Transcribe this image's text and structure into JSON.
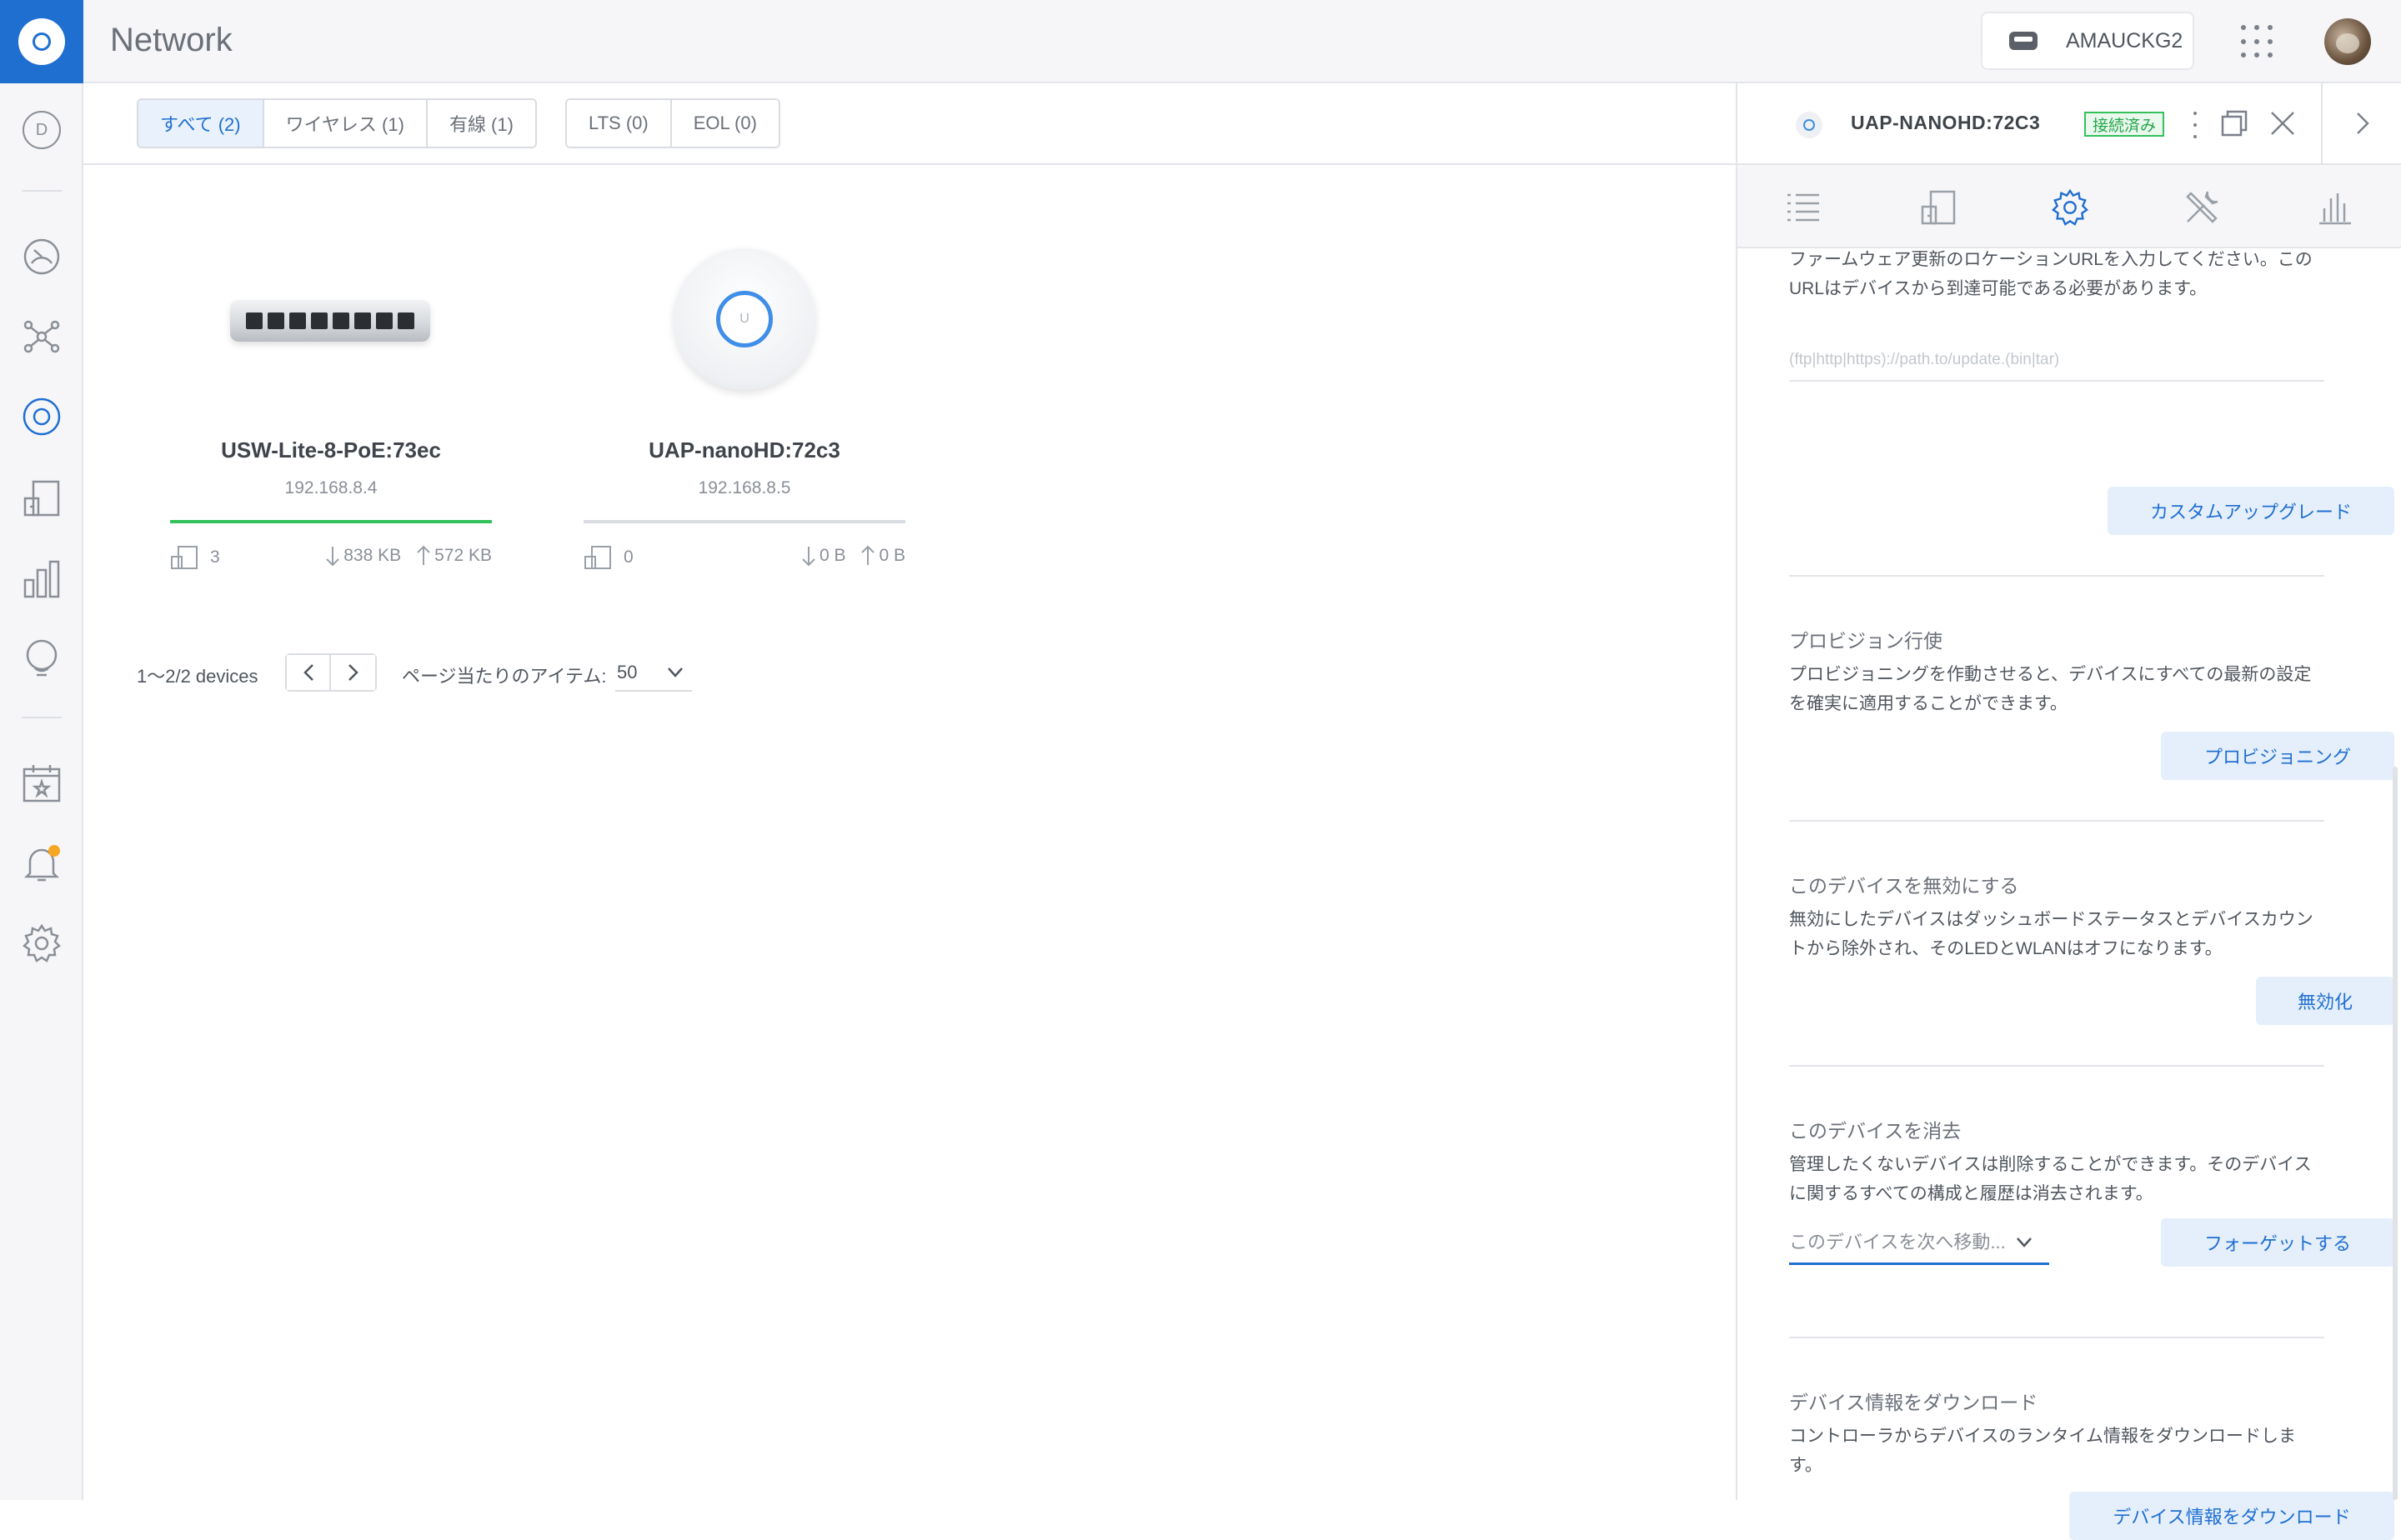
{
  "app": {
    "title": "Network"
  },
  "header": {
    "site_name": "AMAUCKG2"
  },
  "sidebar": {
    "d_label": "D"
  },
  "filters": {
    "group1": [
      "すべて (2)",
      "ワイヤレス (1)",
      "有線 (1)"
    ],
    "group2": [
      "LTS (0)",
      "EOL (0)"
    ],
    "active": "すべて (2)"
  },
  "devices": [
    {
      "name": "USW-Lite-8-PoE:73ec",
      "ip": "192.168.8.4",
      "clients": "3",
      "down": "838 KB",
      "up": "572 KB",
      "status_color": "#34c15b"
    },
    {
      "name": "UAP-nanoHD:72c3",
      "ip": "192.168.8.5",
      "clients": "0",
      "down": "0 B",
      "up": "0 B",
      "status_color": "#d9dce1"
    }
  ],
  "ap_logo_letter": "U",
  "pager": {
    "count": "1〜2/2 devices",
    "per_page_label": "ページ当たりのアイテム:",
    "per_page_value": "50"
  },
  "panel": {
    "device_title": "UAP-NANOHD:72C3",
    "status_badge": "接続済み",
    "firmware_text": "ファームウェア更新のロケーションURLを入力してください。このURLはデバイスから到達可能である必要があります。",
    "url_placeholder": "(ftp|http|https)://path.to/update.(bin|tar)",
    "custom_upgrade_btn": "カスタムアップグレード",
    "provision_title": "プロビジョン行使",
    "provision_desc": "プロビジョニングを作動させると、デバイスにすべての最新の設定を確実に適用することができます。",
    "provision_btn": "プロビジョニング",
    "disable_title": "このデバイスを無効にする",
    "disable_desc": "無効にしたデバイスはダッシュボードステータスとデバイスカウントから除外され、そのLEDとWLANはオフになります。",
    "disable_btn": "無効化",
    "forget_title": "このデバイスを消去",
    "forget_desc": "管理したくないデバイスは削除することができます。そのデバイスに関するすべての構成と履歴は消去されます。",
    "move_placeholder": "このデバイスを次へ移動...",
    "forget_btn": "フォーゲットする",
    "download_title": "デバイス情報をダウンロード",
    "download_desc": "コントローラからデバイスのランタイム情報をダウンロードします。",
    "download_btn": "デバイス情報をダウンロード"
  },
  "colors": {
    "accent": "#1f6fd1",
    "online": "#34c15b",
    "notification": "#f5a623"
  }
}
